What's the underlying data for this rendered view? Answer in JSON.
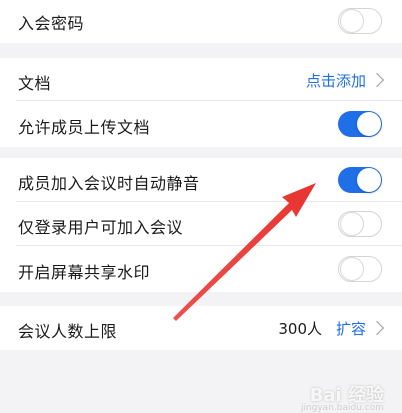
{
  "settings": {
    "meeting_password": {
      "label": "入会密码",
      "enabled": false
    },
    "documents": {
      "label": "文档",
      "action": "点击添加"
    },
    "allow_member_upload": {
      "label": "允许成员上传文档",
      "enabled": true
    },
    "auto_mute_on_join": {
      "label": "成员加入会议时自动静音",
      "enabled": true
    },
    "only_logged_in_users": {
      "label": "仅登录用户可加入会议",
      "enabled": false
    },
    "screen_share_watermark": {
      "label": "开启屏幕共享水印",
      "enabled": false
    },
    "participant_limit": {
      "label": "会议人数上限",
      "value": "300人",
      "action": "扩容"
    }
  },
  "colors": {
    "toggle_on": "#1f6fe8",
    "link": "#1f6fe8",
    "annotation_arrow": "#e8332f"
  },
  "watermark": {
    "text": "Bai 经验",
    "sub": "jingyan.baidu.com"
  }
}
